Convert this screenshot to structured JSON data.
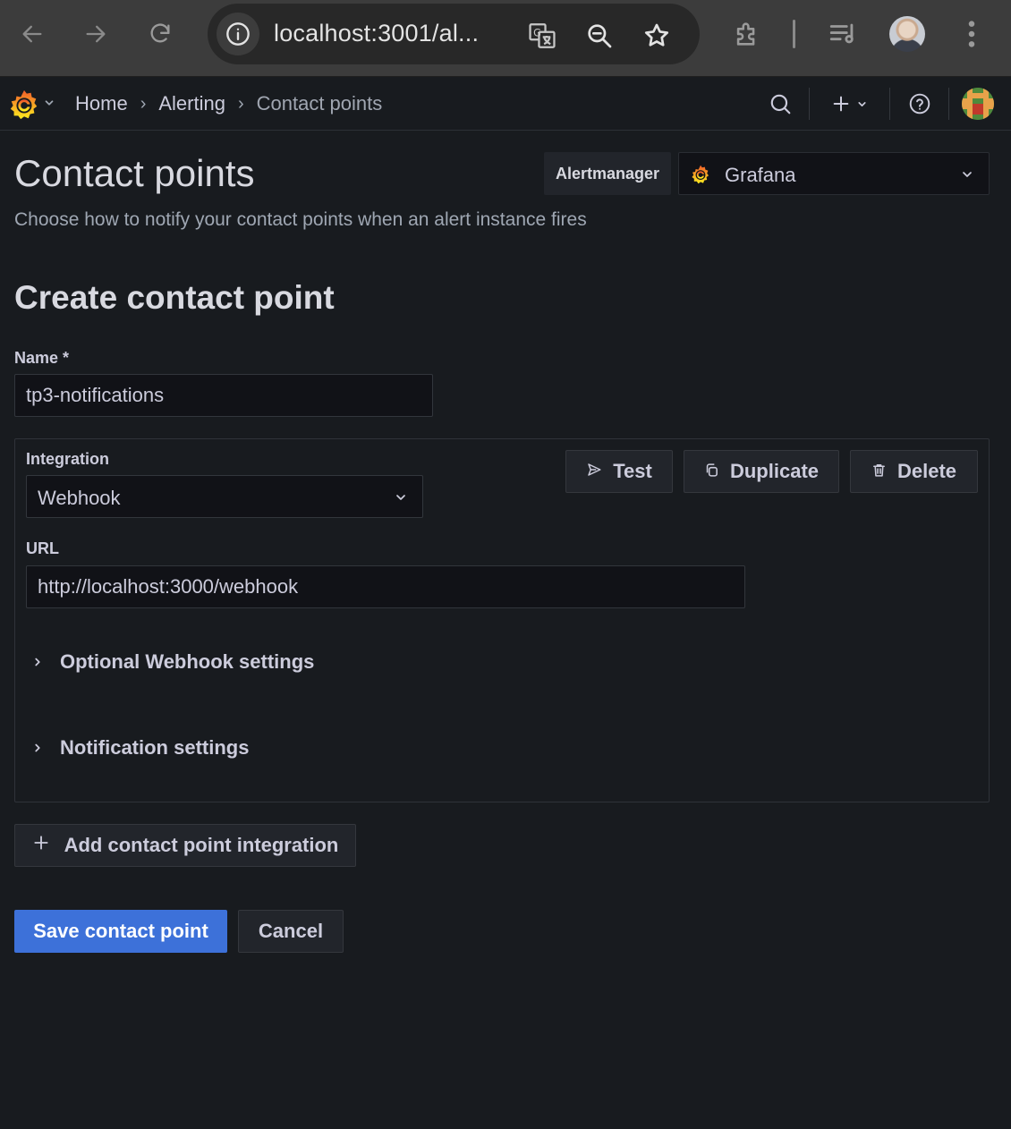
{
  "browser": {
    "url": "localhost:3001/al...",
    "icons": [
      "back-arrow-icon",
      "forward-arrow-icon",
      "reload-icon",
      "info-icon",
      "translate-icon",
      "zoom-icon",
      "star-icon",
      "extensions-icon",
      "reading-list-icon",
      "profile-avatar",
      "kebab-menu-icon"
    ]
  },
  "topnav": {
    "breadcrumbs": [
      "Home",
      "Alerting",
      "Contact points"
    ],
    "icons": [
      "grafana-logo",
      "search-icon",
      "plus-icon",
      "help-icon",
      "user-avatar"
    ]
  },
  "header": {
    "title": "Contact points",
    "subtitle": "Choose how to notify your contact points when an alert instance fires",
    "alertmanager_label": "Alertmanager",
    "alertmanager_value": "Grafana"
  },
  "form": {
    "section_title": "Create contact point",
    "name_label": "Name *",
    "name_value": "tp3-notifications",
    "integration": {
      "label": "Integration",
      "value": "Webhook",
      "test_label": "Test",
      "duplicate_label": "Duplicate",
      "delete_label": "Delete",
      "url_label": "URL",
      "url_value": "http://localhost:3000/webhook",
      "optional_settings_label": "Optional Webhook settings",
      "notification_settings_label": "Notification settings"
    },
    "add_integration_label": "Add contact point integration",
    "save_label": "Save contact point",
    "cancel_label": "Cancel"
  },
  "colors": {
    "primary": "#3d71d9",
    "background": "#181b1f",
    "input_background": "#111217",
    "grafana_orange": "#f05a28"
  }
}
